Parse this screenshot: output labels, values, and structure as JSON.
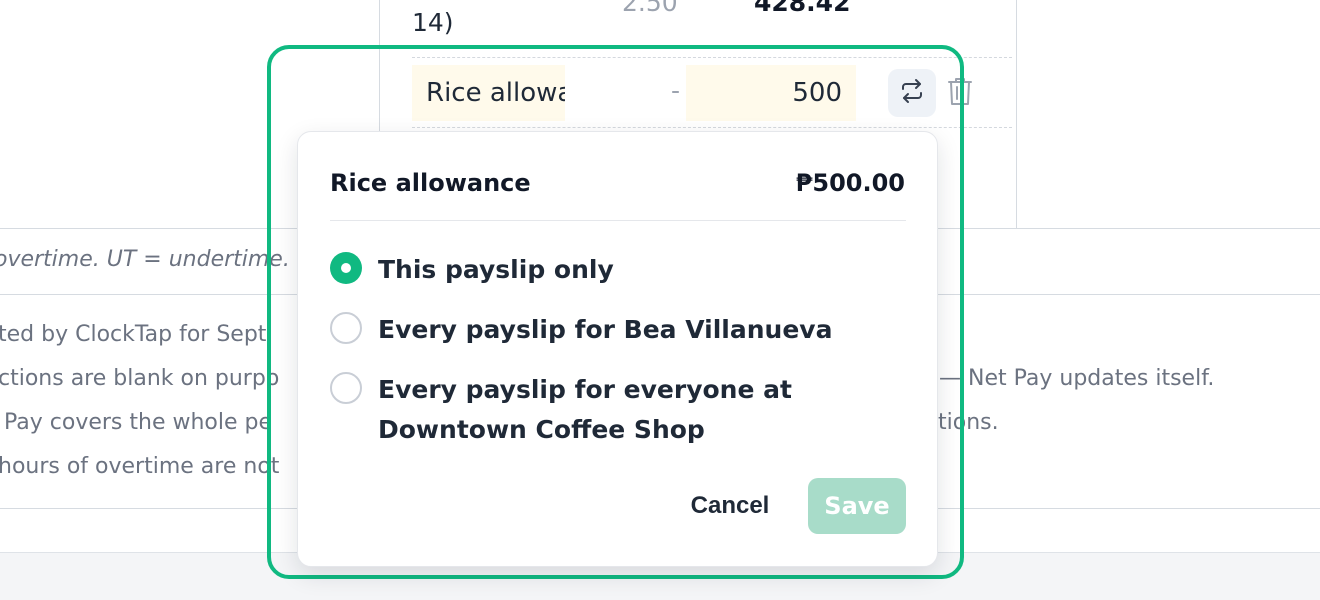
{
  "background": {
    "row_above": {
      "description_fragment": "14)",
      "rate": "2.50",
      "amount": "428.42"
    },
    "editing_row": {
      "name_value": "Rice allowance",
      "dash": "-",
      "amount_value": "500",
      "recur_icon": "repeat-icon",
      "delete_icon": "trash-icon"
    },
    "legend": "overtime. UT = undertime.",
    "notes": [
      "ted by ClockTap for Sept",
      "ctions are blank on purpo",
      "— Net Pay updates itself.",
      "Pay covers the whole pe",
      "tions.",
      "hours of overtime are not"
    ]
  },
  "popover": {
    "title": "Rice allowance",
    "amount": "₱500.00",
    "options": [
      {
        "label": "This payslip only",
        "selected": true
      },
      {
        "label": "Every payslip for Bea Villanueva",
        "selected": false
      },
      {
        "label": "Every payslip for everyone at Downtown Coffee Shop",
        "selected": false
      }
    ],
    "cancel_label": "Cancel",
    "save_label": "Save"
  },
  "colors": {
    "accent": "#10b981",
    "save_disabled": "#a8dcc9",
    "input_highlight": "#fffaeb"
  }
}
